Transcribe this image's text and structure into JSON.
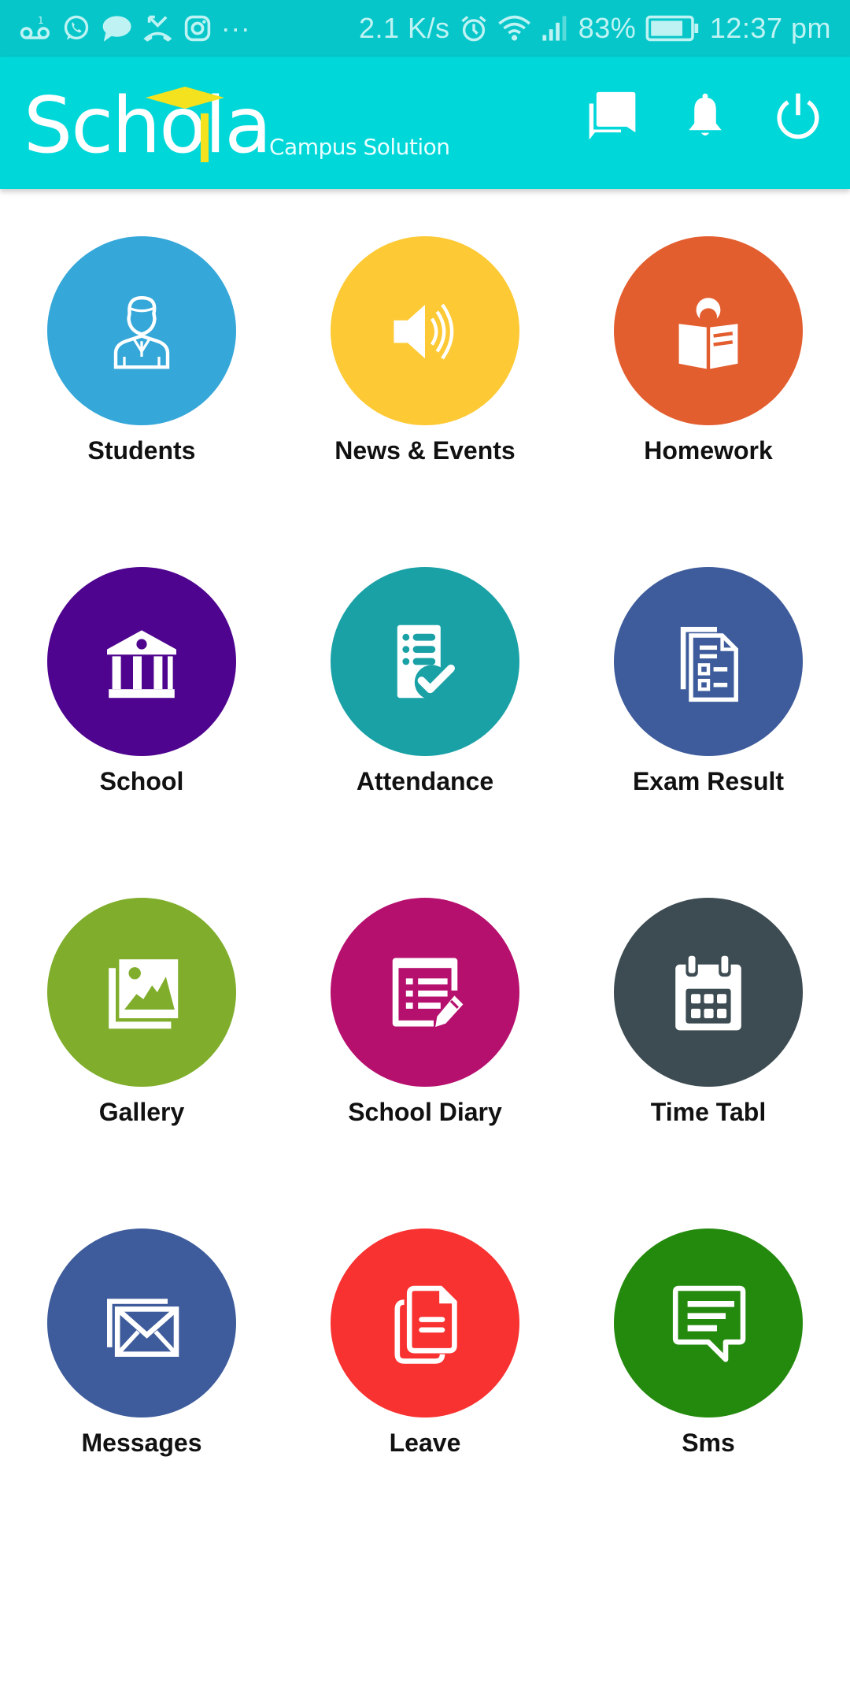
{
  "status_bar": {
    "notification_icons": [
      "voicemail-icon",
      "whatsapp-icon",
      "message-bubble-icon",
      "missed-call-icon",
      "instagram-icon",
      "more-dots-icon"
    ],
    "more_indicator": "···",
    "network_speed": "2.1 K/s",
    "battery_percent": "83%",
    "battery_level": 0.83,
    "time": "12:37 pm"
  },
  "header": {
    "logo_text": "Schola",
    "logo_tagline": "Campus Solution",
    "actions": [
      {
        "name": "chat",
        "icon": "chat-bubbles-icon"
      },
      {
        "name": "notifications",
        "icon": "bell-icon"
      },
      {
        "name": "logout",
        "icon": "power-icon"
      }
    ]
  },
  "colors": {
    "status_bar": "#06c6c9",
    "app_bar": "#00d7d9",
    "logo_accent": "#f4e21e"
  },
  "tiles": [
    {
      "label": "Students",
      "icon": "student-icon",
      "color": "#35a7d9"
    },
    {
      "label": "News & Events",
      "icon": "speaker-icon",
      "color": "#fdc934"
    },
    {
      "label": "Homework",
      "icon": "reading-book-icon",
      "color": "#e35e2f"
    },
    {
      "label": "School",
      "icon": "school-building-icon",
      "color": "#4e048f"
    },
    {
      "label": "Attendance",
      "icon": "checklist-icon",
      "color": "#1aa1a6"
    },
    {
      "label": "Exam Result",
      "icon": "exam-document-icon",
      "color": "#3e5c9b"
    },
    {
      "label": "Gallery",
      "icon": "gallery-icon",
      "color": "#80ae2c"
    },
    {
      "label": "School Diary",
      "icon": "diary-edit-icon",
      "color": "#b6106f"
    },
    {
      "label": "Time Tabl",
      "icon": "calendar-icon",
      "color": "#3d4c52"
    },
    {
      "label": "Messages",
      "icon": "envelope-icon",
      "color": "#3e5c9b"
    },
    {
      "label": "Leave",
      "icon": "documents-icon",
      "color": "#f83131"
    },
    {
      "label": "Sms",
      "icon": "sms-bubble-icon",
      "color": "#248a0d"
    }
  ]
}
